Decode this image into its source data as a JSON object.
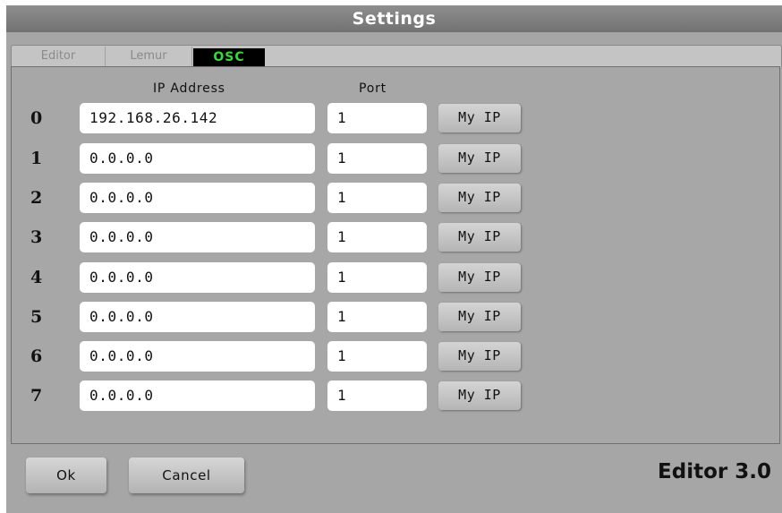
{
  "window": {
    "title": "Settings"
  },
  "tabs": [
    {
      "label": "Editor",
      "active": false
    },
    {
      "label": "Lemur",
      "active": false
    },
    {
      "label": "OSC",
      "active": true
    }
  ],
  "columns": {
    "ip": "IP Address",
    "port": "Port"
  },
  "rows": [
    {
      "index": "0",
      "ip": "192.168.26.142",
      "port": "1",
      "button": "My IP"
    },
    {
      "index": "1",
      "ip": "0.0.0.0",
      "port": "1",
      "button": "My IP"
    },
    {
      "index": "2",
      "ip": "0.0.0.0",
      "port": "1",
      "button": "My IP"
    },
    {
      "index": "3",
      "ip": "0.0.0.0",
      "port": "1",
      "button": "My IP"
    },
    {
      "index": "4",
      "ip": "0.0.0.0",
      "port": "1",
      "button": "My IP"
    },
    {
      "index": "5",
      "ip": "0.0.0.0",
      "port": "1",
      "button": "My IP"
    },
    {
      "index": "6",
      "ip": "0.0.0.0",
      "port": "1",
      "button": "My IP"
    },
    {
      "index": "7",
      "ip": "0.0.0.0",
      "port": "1",
      "button": "My IP"
    }
  ],
  "footer": {
    "ok_label": "Ok",
    "cancel_label": "Cancel",
    "version": "Editor 3.0"
  },
  "colors": {
    "active_tab_bg": "#000000",
    "active_tab_text": "#33dd33",
    "dialog_bg": "#a6a6a6"
  }
}
